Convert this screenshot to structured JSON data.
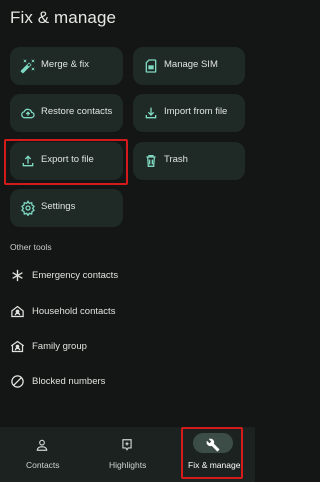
{
  "header": {
    "title": "Fix & manage"
  },
  "cards": [
    {
      "label": "Merge & fix",
      "icon": "magic-wand-icon"
    },
    {
      "label": "Manage SIM",
      "icon": "sim-card-icon"
    },
    {
      "label": "Restore contacts",
      "icon": "cloud-restore-icon"
    },
    {
      "label": "Import from file",
      "icon": "download-icon"
    },
    {
      "label": "Export to file",
      "icon": "upload-icon"
    },
    {
      "label": "Trash",
      "icon": "trash-icon"
    },
    {
      "label": "Settings",
      "icon": "gear-icon"
    }
  ],
  "other_tools": {
    "heading": "Other tools",
    "items": [
      {
        "label": "Emergency contacts",
        "icon": "asterisk-icon"
      },
      {
        "label": "Household contacts",
        "icon": "home-person-icon"
      },
      {
        "label": "Family group",
        "icon": "family-icon"
      },
      {
        "label": "Blocked numbers",
        "icon": "block-icon"
      }
    ]
  },
  "bottom_nav": [
    {
      "label": "Contacts",
      "icon": "person-icon"
    },
    {
      "label": "Highlights",
      "icon": "highlights-icon"
    },
    {
      "label": "Fix & manage",
      "icon": "wrench-icon",
      "selected": true
    }
  ],
  "colors": {
    "accent": "#7fd8c0",
    "card_bg": "#1f2a27",
    "background": "#131614",
    "highlight": "#d31b1b"
  }
}
